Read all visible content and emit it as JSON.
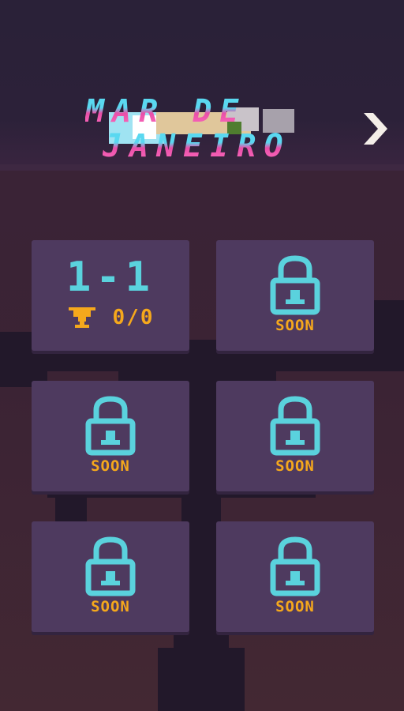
{
  "title": {
    "line1": "MAR DE",
    "line2": "JANEIRO"
  },
  "navigation": {
    "next_icon": "chevron-right-icon"
  },
  "levels": [
    {
      "label": "1-1",
      "trophy_icon": "trophy-icon",
      "score": "0/0",
      "locked": false
    },
    {
      "status": "SOON",
      "icon": "lock-icon",
      "locked": true
    },
    {
      "status": "SOON",
      "icon": "lock-icon",
      "locked": true
    },
    {
      "status": "SOON",
      "icon": "lock-icon",
      "locked": true
    },
    {
      "status": "SOON",
      "icon": "lock-icon",
      "locked": true
    },
    {
      "status": "SOON",
      "icon": "lock-icon",
      "locked": true
    }
  ],
  "colors": {
    "tile": "#4e3a5f",
    "accent_cyan": "#5ad2dd",
    "accent_gold": "#f5a81c",
    "title_pink": "#e94fa8"
  }
}
